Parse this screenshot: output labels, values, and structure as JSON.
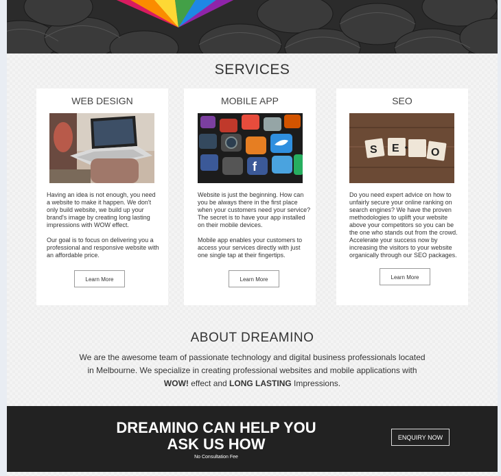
{
  "services": {
    "title": "SERVICES",
    "cards": [
      {
        "title": "WEB DESIGN",
        "image": "laptop-photo",
        "paragraphs": [
          "Having an idea is not enough, you need a website to make it happen. We don't only build website, we build up your brand's image by creating long lasting impressions with WOW effect.",
          "Our goal is to focus on delivering you a professional and responsive website with an affordable price."
        ],
        "button": "Learn More"
      },
      {
        "title": "MOBILE APP",
        "image": "app-icons-photo",
        "paragraphs": [
          "Website is just the beginning. How can you be always there in the first place when your customers need your service? The secret is to have your app installed on their mobile devices.",
          "Mobile app enables your customers to access your services directly with just one single tap at their fingertips."
        ],
        "button": "Learn More"
      },
      {
        "title": "SEO",
        "image": "seo-tiles-photo",
        "image_letters": [
          "S",
          "E",
          "O"
        ],
        "paragraphs": [
          "Do you need expert advice on how to unfairly secure your online ranking on search engines? We have the proven methodologies to uplift your website above your competitors so you can be the one who stands out from the crowd. Accelerate your success now by increasing the visitors to your website organically through our SEO packages."
        ],
        "button": "Learn More"
      }
    ]
  },
  "about": {
    "title": "ABOUT DREAMINO",
    "text_part1": "We are the awesome team of passionate technology and digital business professionals located in Melbourne. We specialize in creating professional websites and mobile applications with ",
    "bold1": "WOW!",
    "text_part2": " effect and ",
    "bold2": "LONG LASTING",
    "text_part3": " Impressions."
  },
  "cta": {
    "line1": "DREAMINO CAN HELP YOU",
    "line2": "ASK US HOW",
    "subtext": "No Consultation Fee",
    "button": "ENQUIRY NOW"
  },
  "colors": {
    "cta_background": "#222222",
    "card_background": "#ffffff",
    "page_background": "#f4f4f4"
  }
}
